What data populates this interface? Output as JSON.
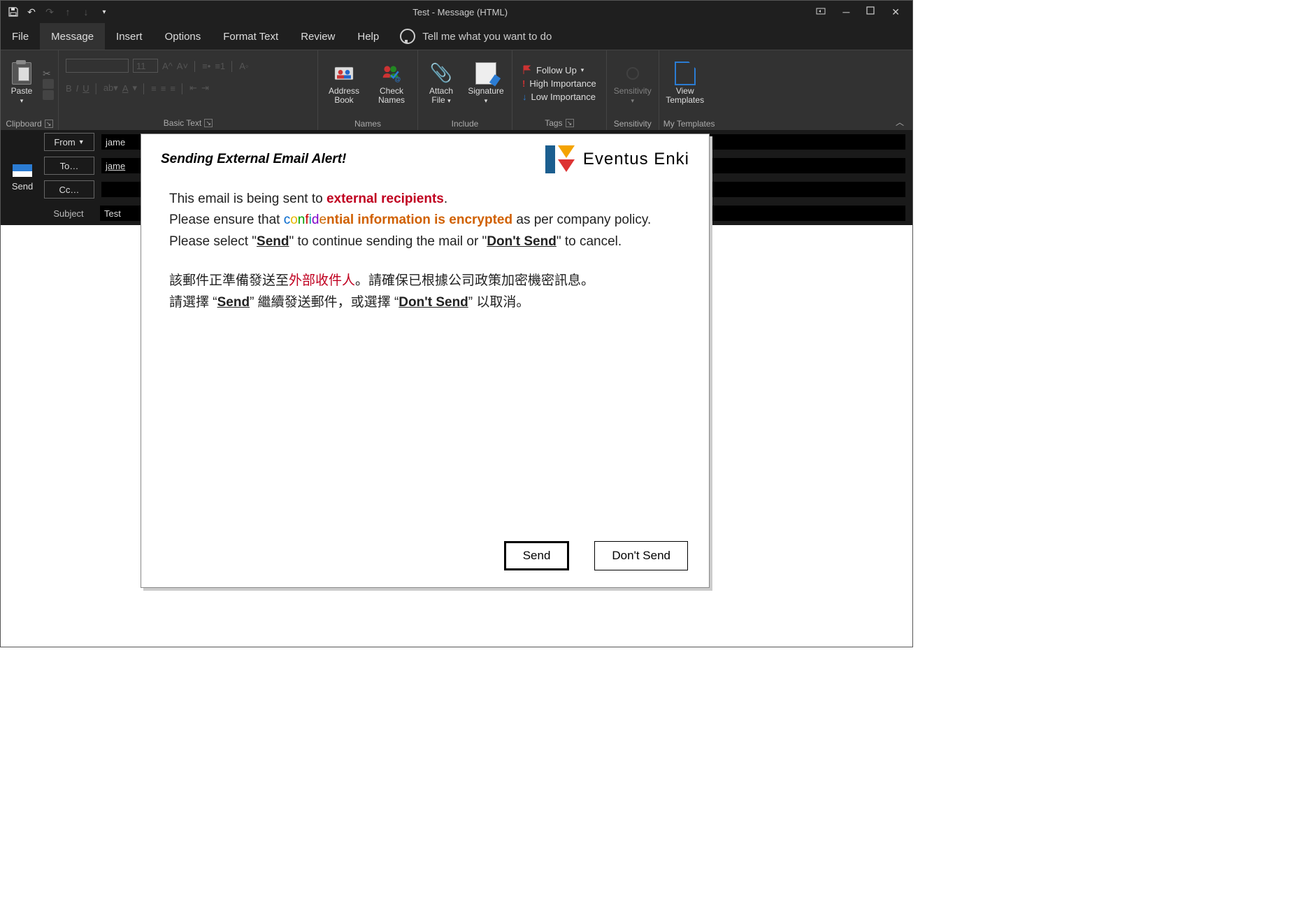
{
  "window": {
    "title": "Test  -  Message (HTML)"
  },
  "tabs": {
    "file": "File",
    "message": "Message",
    "insert": "Insert",
    "options": "Options",
    "format_text": "Format Text",
    "review": "Review",
    "help": "Help",
    "tell_me": "Tell me what you want to do"
  },
  "ribbon": {
    "paste": "Paste",
    "clipboard_group": "Clipboard",
    "font_size_sample": "11",
    "basic_text_group": "Basic Text",
    "address_book": "Address Book",
    "check_names": "Check Names",
    "names_group": "Names",
    "attach_file": "Attach File",
    "signature": "Signature",
    "include_group": "Include",
    "follow_up": "Follow Up",
    "high_importance": "High Importance",
    "low_importance": "Low Importance",
    "tags_group": "Tags",
    "sensitivity": "Sensitivity",
    "sensitivity_group": "Sensitivity",
    "view_templates": "View Templates",
    "my_templates_group": "My Templates"
  },
  "compose": {
    "send": "Send",
    "from_label": "From",
    "to_label": "To…",
    "cc_label": "Cc…",
    "subject_label": "Subject",
    "from_value": "jame",
    "to_value": "jame",
    "cc_value": "",
    "subject_value": "Test"
  },
  "dialog": {
    "title": "Sending External Email Alert!",
    "brand": "Eventus Enki",
    "line1_pre": "This email is being sent to ",
    "line1_ext": "external recipients",
    "line1_post": ".",
    "line2_pre": "Please ensure that ",
    "line2_conf": "confidential",
    "line2_enc": " information is encrypted",
    "line2_post": " as per company policy.",
    "line3_pre": "Please select \"",
    "line3_send": "Send",
    "line3_mid": "\" to continue sending the mail or \"",
    "line3_dont": "Don't Send",
    "line3_post": "\" to cancel.",
    "zh1_pre": "該郵件正準備發送至",
    "zh1_ext": "外部收件人",
    "zh1_post": "。請確保已根據公司政策加密機密訊息。",
    "zh2_pre": "請選擇 “",
    "zh2_send": "Send",
    "zh2_mid": "” 繼續發送郵件，或選擇 “",
    "zh2_dont": "Don't Send",
    "zh2_post": "” 以取消。",
    "btn_send": "Send",
    "btn_dont": "Don't Send"
  }
}
